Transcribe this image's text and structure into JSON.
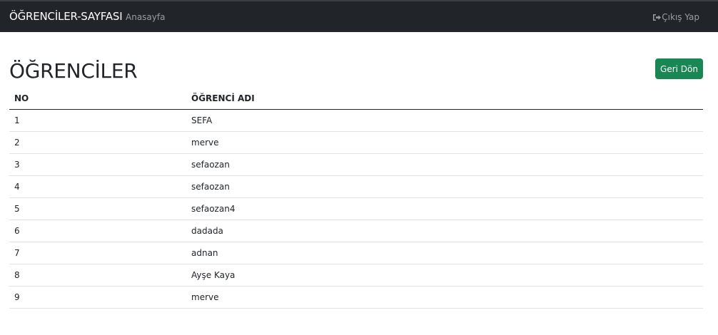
{
  "navbar": {
    "brand": "ÖĞRENCİLER-SAYFASI",
    "home_link": "Anasayfa",
    "logout_label": "Çıkış Yap",
    "logout_icon": "sign-out-icon"
  },
  "main": {
    "title": "ÖĞRENCİLER",
    "back_button": "Geri Dön",
    "back_button_color": "#198754"
  },
  "table": {
    "headers": [
      "NO",
      "ÖĞRENCİ ADI"
    ],
    "rows": [
      {
        "no": "1",
        "name": "SEFA"
      },
      {
        "no": "2",
        "name": "merve"
      },
      {
        "no": "3",
        "name": "sefaozan"
      },
      {
        "no": "4",
        "name": "sefaozan"
      },
      {
        "no": "5",
        "name": "sefaozan4"
      },
      {
        "no": "6",
        "name": "dadada"
      },
      {
        "no": "7",
        "name": "adnan"
      },
      {
        "no": "8",
        "name": "Ayşe Kaya"
      },
      {
        "no": "9",
        "name": "merve"
      }
    ]
  }
}
